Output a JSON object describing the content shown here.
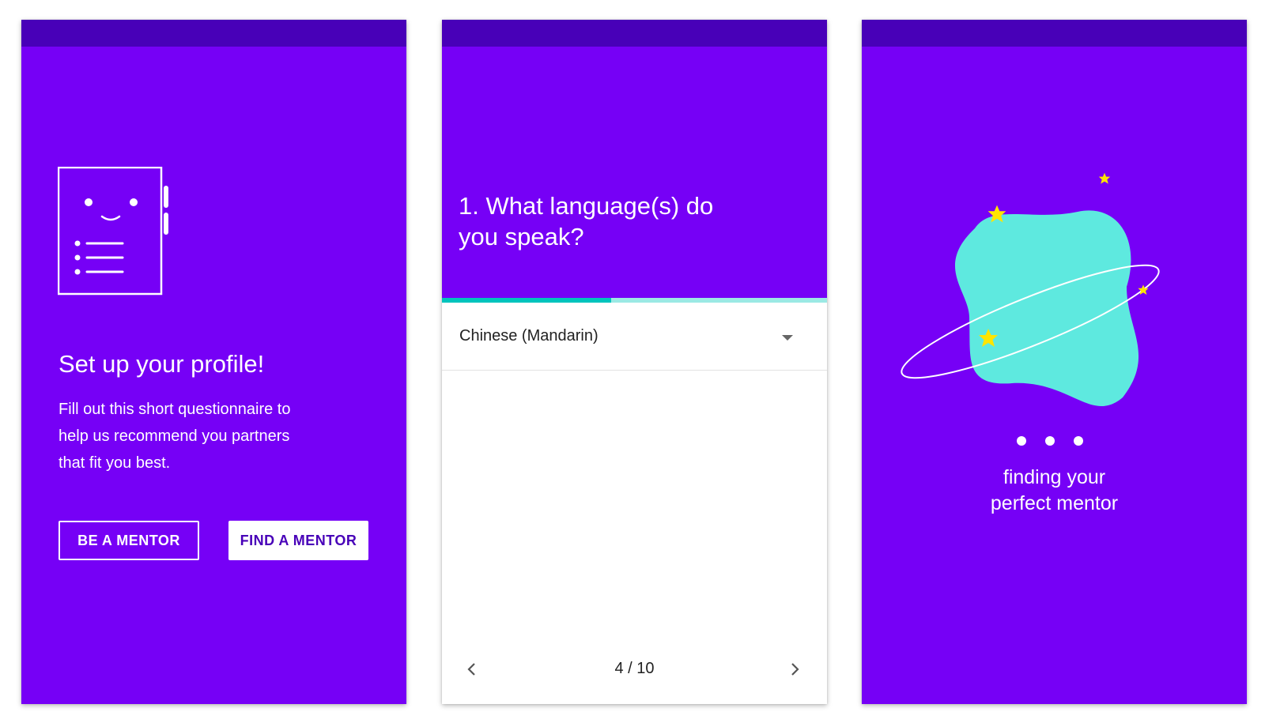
{
  "colors": {
    "primary": "#7600f6",
    "primary_dark": "#4800b8",
    "accent_teal": "#00c4bd",
    "progress_track": "#9be9e4",
    "blob": "#5ee9df",
    "star": "#ffe500",
    "text_dark": "#222222",
    "white": "#ffffff"
  },
  "screen1": {
    "icon": "profile-document-icon",
    "title": "Set up your profile!",
    "body": "Fill out this short questionnaire to help us recommend you partners that fit you best.",
    "buttons": {
      "be_mentor": "BE A MENTOR",
      "find_mentor": "FIND A MENTOR"
    }
  },
  "screen2": {
    "question": "1. What language(s) do you speak?",
    "progress": 0.44,
    "dropdown": {
      "selected": "Chinese (Mandarin)",
      "icon": "dropdown-arrow-icon"
    },
    "pager": {
      "count": "4 / 10",
      "prev_icon": "chevron-left-icon",
      "next_icon": "chevron-right-icon"
    }
  },
  "screen3": {
    "illustration": "planet-icon",
    "loading_icon": "loading-dots-icon",
    "message_line1": "finding your",
    "message_line2": "perfect mentor"
  }
}
